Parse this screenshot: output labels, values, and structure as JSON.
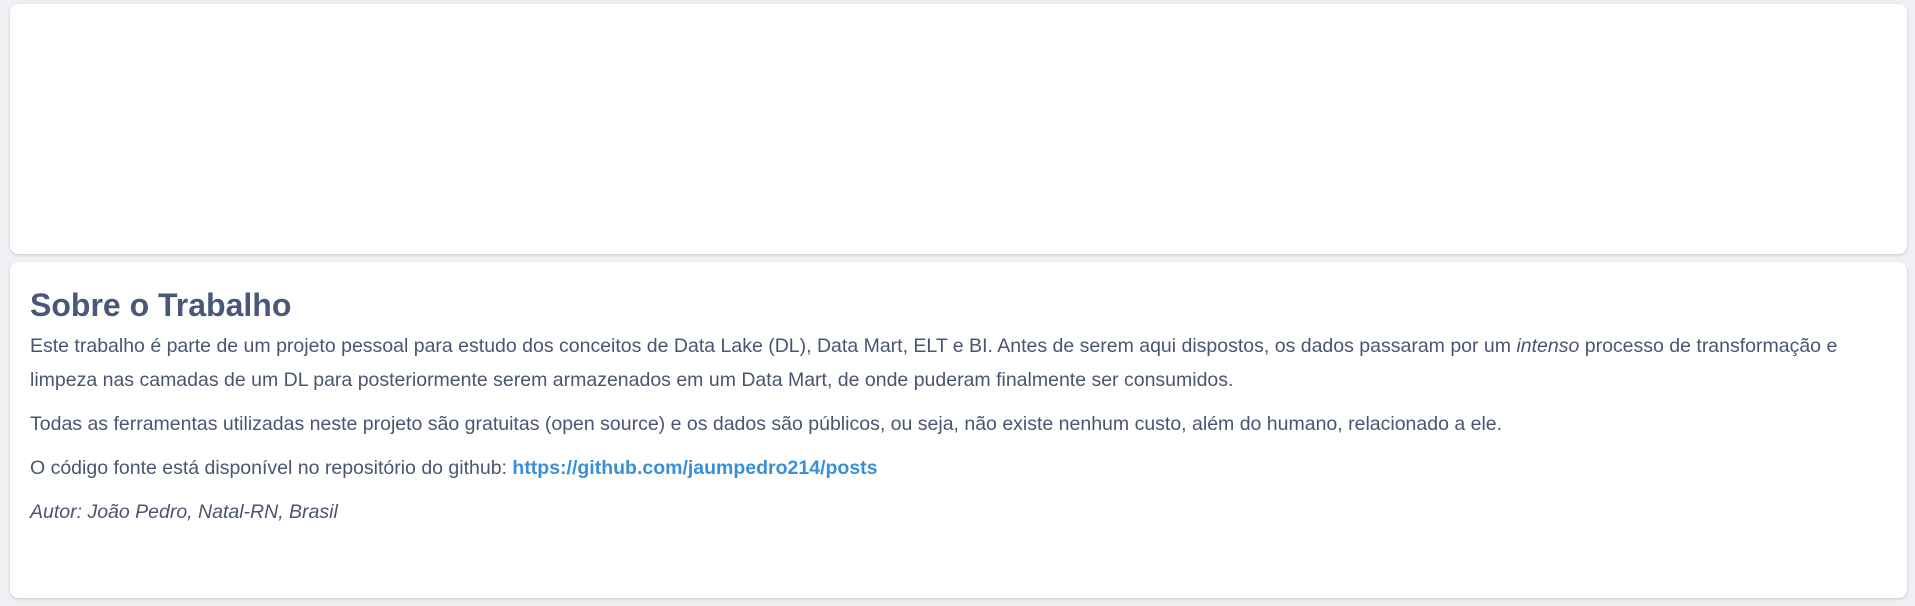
{
  "about": {
    "title": "Sobre o Trabalho",
    "para1": {
      "before": "Este trabalho é parte de um projeto pessoal para estudo dos conceitos de Data Lake (DL), Data Mart, ELT e BI. Antes de serem aqui dispostos, os dados passaram por um ",
      "emphasis": "intenso",
      "after": " processo de transformação e limpeza nas camadas de um DL para posteriormente serem armazenados em um Data Mart, de onde puderam finalmente ser consumidos."
    },
    "para2": "Todas as ferramentas utilizadas neste projeto são gratuitas (open source) e os dados são públicos, ou seja, não existe nenhum custo, além do humano, relacionado a ele.",
    "para3_prefix": "O código fonte está disponível no repositório do github: ",
    "repo_link": "https://github.com/jaumpedro214/posts",
    "author": "Autor: João Pedro, Natal-RN, Brasil"
  }
}
